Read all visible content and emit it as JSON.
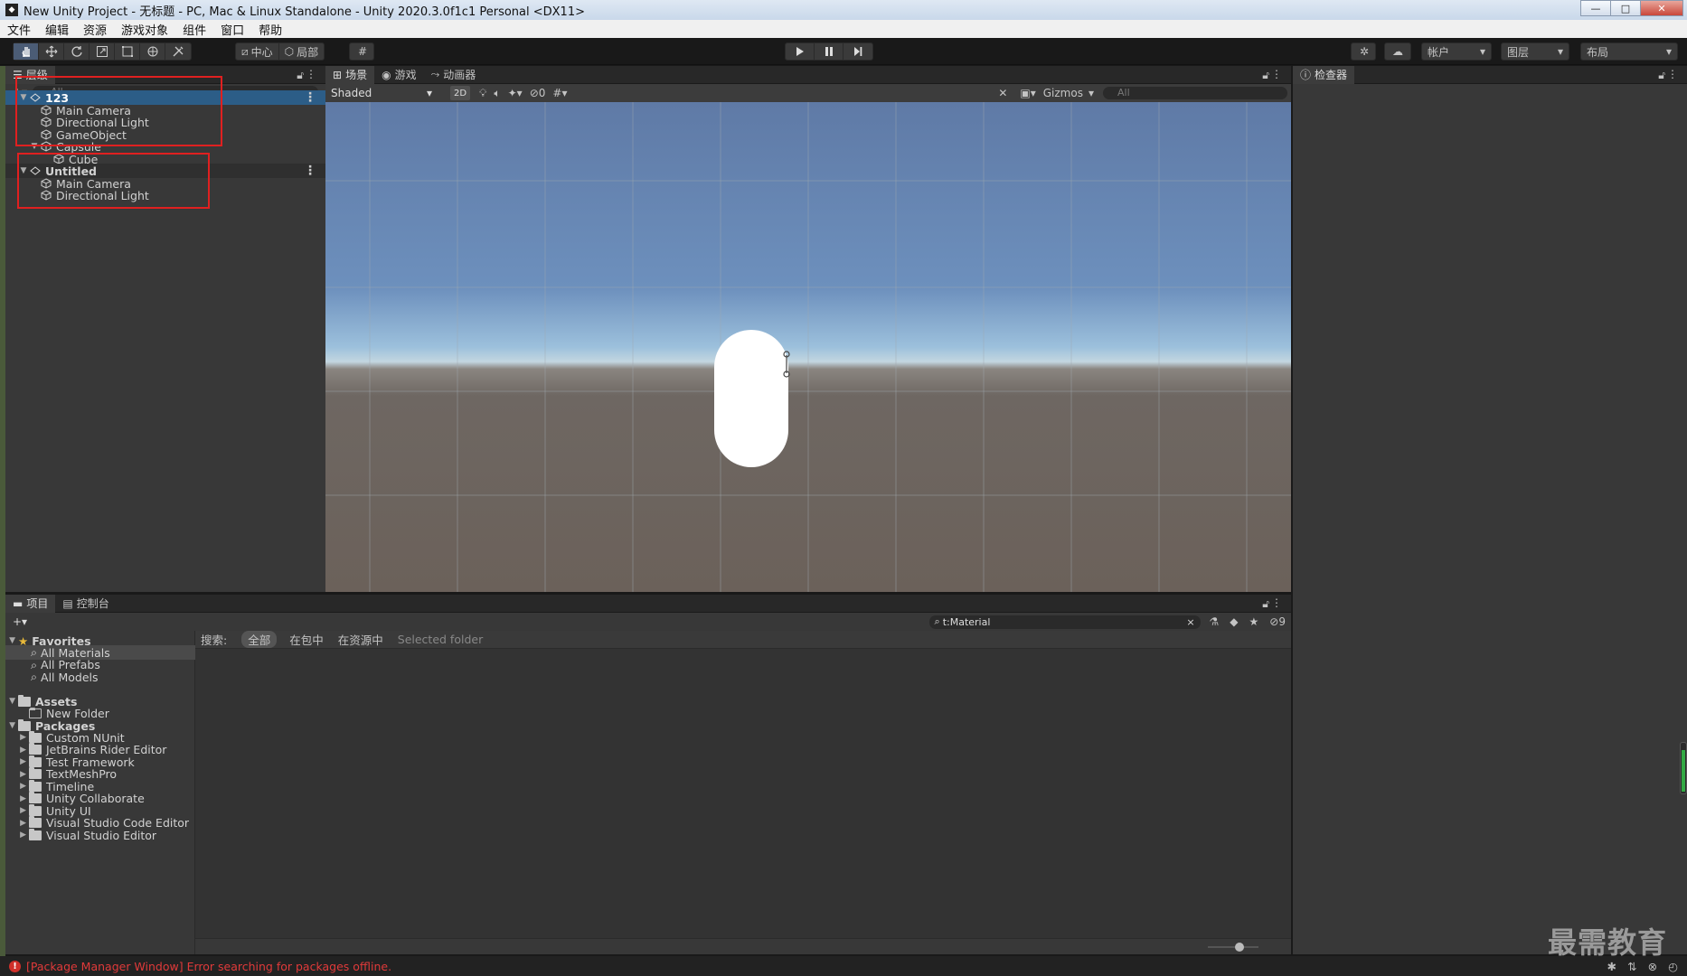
{
  "window": {
    "title": "New Unity Project - 无标题 - PC, Mac & Linux Standalone - Unity 2020.3.0f1c1 Personal <DX11>",
    "buttons": [
      "—",
      "□",
      "✕"
    ]
  },
  "menubar": [
    "文件",
    "编辑",
    "资源",
    "游戏对象",
    "组件",
    "窗口",
    "帮助"
  ],
  "toolbar": {
    "tools": [
      "hand-icon",
      "move-icon",
      "rotate-icon",
      "scale-icon",
      "rect-icon",
      "transform-icon",
      "custom-tool-icon"
    ],
    "pivot_label": "中心",
    "space_label": "局部",
    "account_label": "帐户",
    "layers_label": "图层",
    "layout_label": "布局"
  },
  "hierarchy": {
    "tab_label": "层级",
    "search_placeholder": "All",
    "items": [
      {
        "label": "123",
        "type": "scene",
        "selected": true
      },
      {
        "label": "Main Camera",
        "depth": 1
      },
      {
        "label": "Directional Light",
        "depth": 1
      },
      {
        "label": "GameObject",
        "depth": 1
      },
      {
        "label": "Capsule",
        "depth": 1,
        "expanded": true
      },
      {
        "label": "Cube",
        "depth": 2
      },
      {
        "label": "Untitled",
        "type": "scene"
      },
      {
        "label": "Main Camera",
        "depth": 1
      },
      {
        "label": "Directional Light",
        "depth": 1
      }
    ]
  },
  "scene_view": {
    "tabs": [
      "场景",
      "游戏",
      "动画器"
    ],
    "shading_mode": "Shaded",
    "btn_2d": "2D",
    "hidden_count": "0",
    "gizmos_label": "Gizmos",
    "search_placeholder": "All"
  },
  "inspector": {
    "tab_label": "检查器"
  },
  "project": {
    "tabs": [
      "项目",
      "控制台"
    ],
    "search_value": "t:Material",
    "filter_label": "搜索:",
    "filters": [
      "全部",
      "在包中",
      "在资源中",
      "Selected folder"
    ],
    "hidden_count": "9",
    "favorites_label": "Favorites",
    "favorites": [
      "All Materials",
      "All Prefabs",
      "All Models"
    ],
    "assets_label": "Assets",
    "assets": [
      "New Folder"
    ],
    "packages_label": "Packages",
    "packages": [
      "Custom NUnit",
      "JetBrains Rider Editor",
      "Test Framework",
      "TextMeshPro",
      "Timeline",
      "Unity Collaborate",
      "Unity UI",
      "Visual Studio Code Editor",
      "Visual Studio Editor"
    ]
  },
  "status": {
    "message": "[Package Manager Window] Error searching for packages offline."
  },
  "watermark": "最需教育",
  "colors": {
    "selection": "#2c5d87",
    "error": "#e03a3a",
    "highlight_box": "#e02020"
  }
}
